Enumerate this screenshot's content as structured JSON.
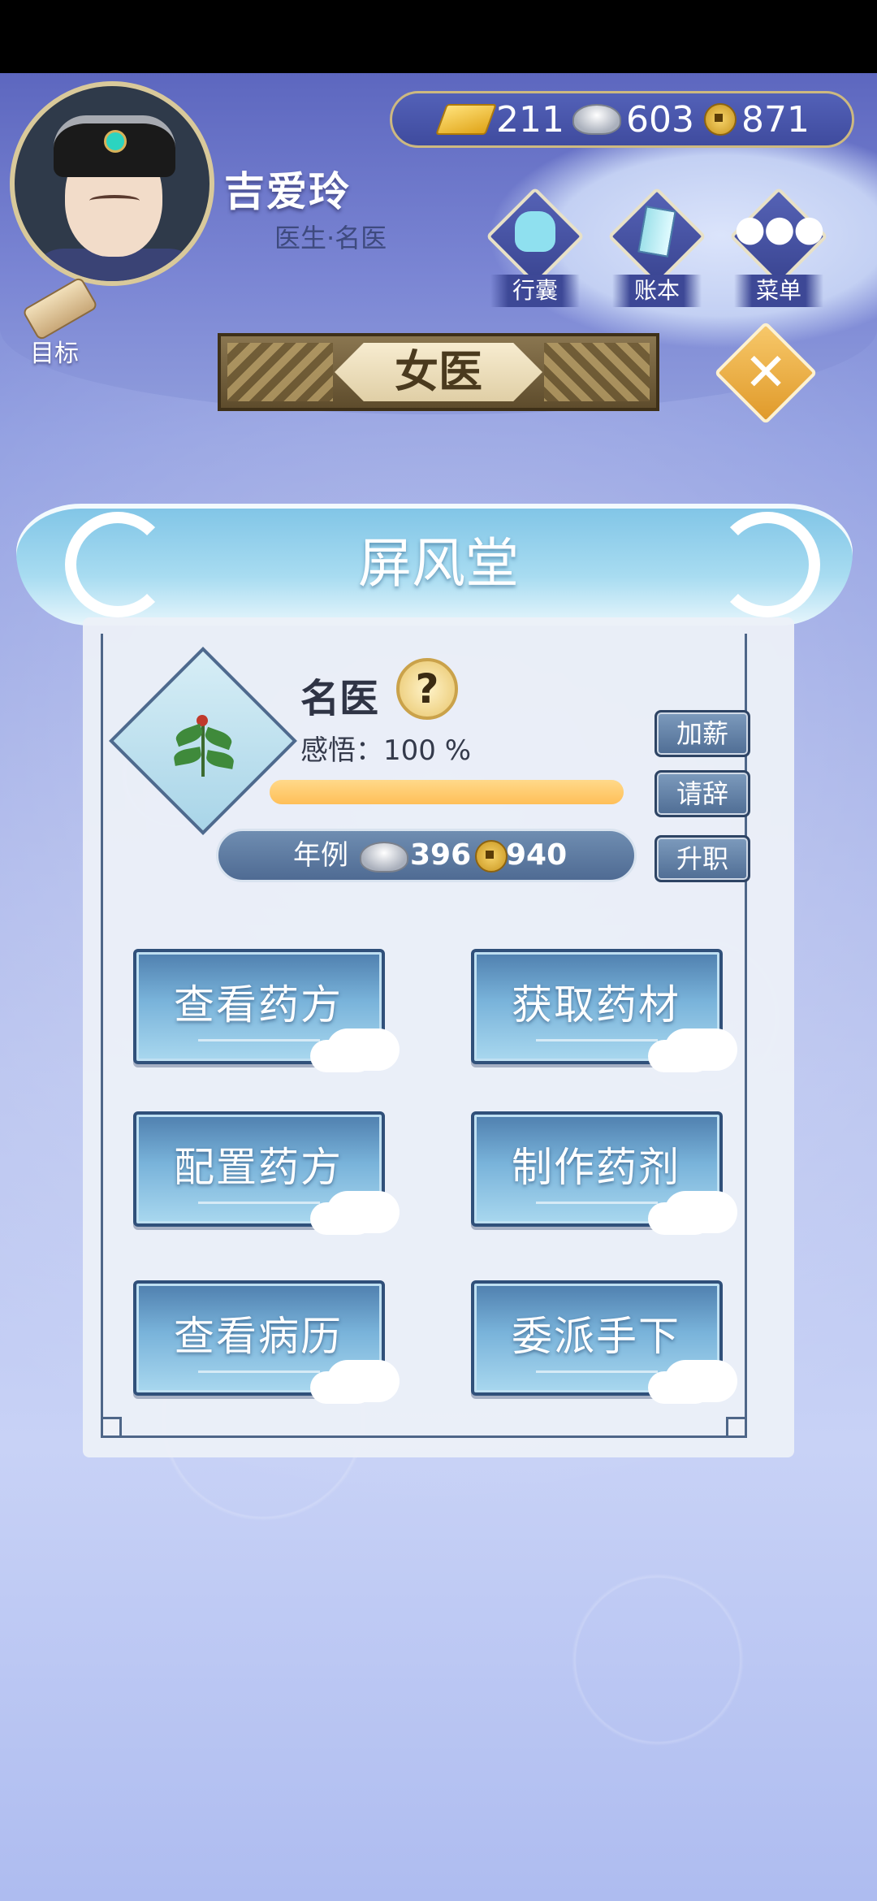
{
  "player": {
    "name": "吉爱玲",
    "title": "医生·名医"
  },
  "currency": {
    "gold": "211",
    "silver": "603",
    "coins": "871"
  },
  "top_menu": {
    "bag_label": "行囊",
    "ledger_label": "账本",
    "menu_label": "菜单",
    "goal_label": "目标"
  },
  "page": {
    "banner_title": "女医",
    "close_glyph": "✕",
    "hall_name": "屏风堂"
  },
  "doctor": {
    "rank": "名医",
    "help_glyph": "?",
    "insight_text": "感悟：100 %",
    "insight_progress": 1.0,
    "salary_label": "年例",
    "salary_silver": "396",
    "salary_coins": "940"
  },
  "side_actions": {
    "raise": "加薪",
    "resign": "请辞",
    "promote": "升职"
  },
  "actions": {
    "view_prescriptions": "查看药方",
    "get_herbs": "获取药材",
    "configure_prescriptions": "配置药方",
    "make_medicine": "制作药剂",
    "view_records": "查看病历",
    "assign_subordinates": "委派手下"
  },
  "colors": {
    "accent_gold": "#e0a418",
    "panel_blue": "#4f6d94",
    "progress_fill": "#ffbf58"
  }
}
